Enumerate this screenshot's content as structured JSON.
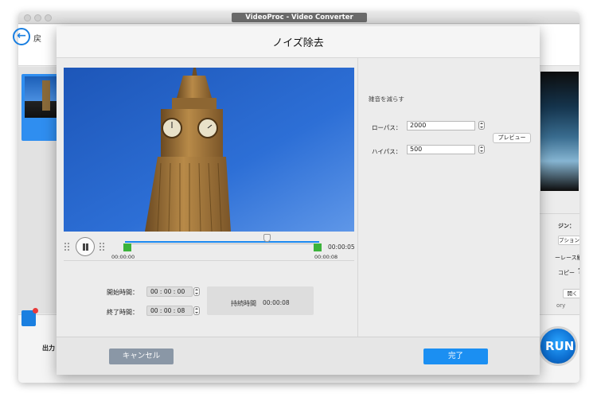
{
  "app": {
    "title": "VideoProc - Video Converter",
    "back_label": "戻",
    "output_label": "出力",
    "run_label": "RUN",
    "right_panel": {
      "option_title": "ジン：",
      "option_button": "プション",
      "interlace_label": "ーレース解除",
      "copy_label": "コピー",
      "help_symbol": "?",
      "open_button": "開く",
      "folder_partial": "ory"
    }
  },
  "dialog": {
    "title": "ノイズ除去",
    "player": {
      "start_time_small": "00:00:00",
      "end_time_small": "00:00:08",
      "current_time": "00:00:05"
    },
    "trim": {
      "start_label": "開始時間：",
      "start_value": "00 : 00 : 00",
      "end_label": "終了時間：",
      "end_value": "00 : 00 : 08",
      "duration_label": "持続時間",
      "duration_value": "00:00:08"
    },
    "noise": {
      "section_title": "雑音を減らす",
      "lowpass_label": "ローパス：",
      "lowpass_value": "2000",
      "highpass_label": "ハイパス：",
      "highpass_value": "500",
      "preview_label": "プレビュー"
    },
    "footer": {
      "cancel_label": "キャンセル",
      "done_label": "完了"
    }
  },
  "colors": {
    "accent": "#1b8ff2",
    "cancel": "#8a97a6",
    "trim_marker": "#3bb33b",
    "progress_track": "#1a88f0"
  }
}
